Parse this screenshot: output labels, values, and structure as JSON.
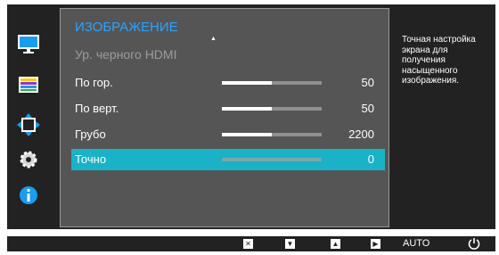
{
  "menu": {
    "title": "ИЗОБРАЖЕНИЕ",
    "subtitle": "Ур. черного HDMI",
    "items": [
      {
        "label": "По гор.",
        "value": "50",
        "level": 0.5,
        "selected": false
      },
      {
        "label": "По верт.",
        "value": "50",
        "level": 0.5,
        "selected": false
      },
      {
        "label": "Грубо",
        "value": "2200",
        "level": 0.5,
        "selected": false
      },
      {
        "label": "Точно",
        "value": "0",
        "level": 0,
        "selected": true
      }
    ]
  },
  "help_text": "Точная настройка экрана для получения насыщенного изображения.",
  "sidebar": {
    "icons": [
      "monitor-icon",
      "color-bars-icon",
      "resize-arrows-icon",
      "gear-icon",
      "info-icon"
    ],
    "active": "resize-arrows-icon"
  },
  "bottom_bar": {
    "keys": [
      "close-key-icon",
      "down-key-icon",
      "up-key-icon",
      "right-key-icon"
    ],
    "auto_label": "AUTO",
    "power_icon": "power-icon"
  },
  "colors": {
    "title": "#2ba3ff",
    "selection": "#19b2c7",
    "panel": "#555555",
    "background": "#222222"
  }
}
